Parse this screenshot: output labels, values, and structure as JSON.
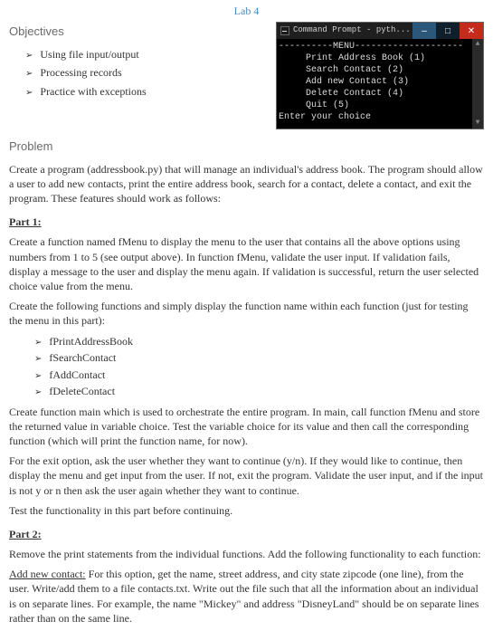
{
  "lab_title": "Lab 4",
  "objectives": {
    "heading": "Objectives",
    "items": [
      "Using file input/output",
      "Processing records",
      "Practice with exceptions"
    ]
  },
  "terminal": {
    "title": "Command Prompt - pyth...",
    "min_glyph": "–",
    "max_glyph": "□",
    "close_glyph": "✕",
    "scroll_up": "▲",
    "scroll_down": "▼",
    "lines": "----------MENU--------------------\n     Print Address Book (1)\n     Search Contact (2)\n     Add new Contact (3)\n     Delete Contact (4)\n     Quit (5)\nEnter your choice"
  },
  "problem": {
    "heading": "Problem",
    "intro": "Create a program (addressbook.py) that will manage an individual's address book. The program should allow a user to add new contacts, print the entire address book, search for a contact, delete a contact, and exit the program. These features should work as follows:"
  },
  "part1": {
    "heading": "Part 1:",
    "p1": "Create a function named fMenu to display the menu to the user that contains all the above options using numbers from 1 to 5 (see output above). In function fMenu, validate the user input. If validation fails, display a message to the user and display the menu again. If validation is successful, return the user selected choice value from the menu.",
    "p2": "Create the following functions and simply display the function name within each function (just for testing the menu in this part):",
    "fns": [
      "fPrintAddressBook",
      "fSearchContact",
      "fAddContact",
      "fDeleteContact"
    ],
    "p3": "Create function main which is used to orchestrate the entire program. In main, call function fMenu and store the returned value in variable choice. Test the variable choice for its value and then call the corresponding function (which will print the function name, for now).",
    "p4": "For the exit option, ask the user whether they want to continue (y/n). If they would like to continue, then display the menu and get input from the user. If not, exit the program. Validate the user input, and if the input is not y or n then ask the user again whether they want to continue.",
    "p5": "Test the functionality in this part before continuing."
  },
  "part2": {
    "heading": "Part 2:",
    "p1": "Remove the print statements from the individual functions. Add the following functionality to each function:",
    "add_new_label": "Add new contact:",
    "add_new_text": " For this option, get the name, street address, and city state zipcode (one line), from the user. Write/add them to a file contacts.txt. Write out the file such that all the information about an individual is on separate lines. For example, the name \"Mickey\" and address \"DisneyLand\" should be on separate lines rather than on the same line."
  }
}
